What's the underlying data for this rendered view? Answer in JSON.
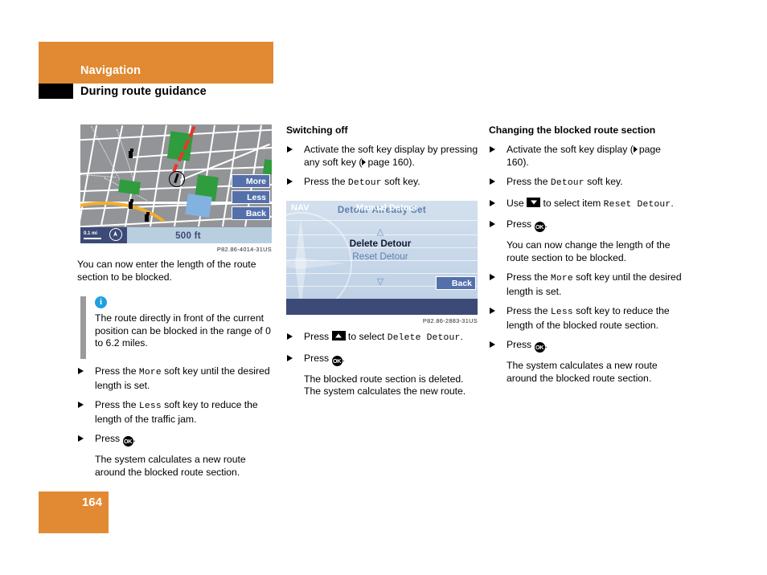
{
  "header": {
    "chapter": "Navigation",
    "section": "During route guidance"
  },
  "page": {
    "number": "164"
  },
  "figures": {
    "map": {
      "caption": "P82.86-4014-31US",
      "softkeys": [
        "More",
        "Less",
        "Back"
      ],
      "scale_label": "0.1 mi",
      "distance": "500 ft"
    },
    "detour": {
      "caption": "P82.86-2883-31US",
      "title": "Detour Already Set",
      "up_arrow": "△",
      "down_arrow": "▽",
      "item_selected": "Delete Detour",
      "item_other": "Reset Detour",
      "back_key": "Back",
      "footer_left": "NAV",
      "footer_center": "Manual Detour"
    }
  },
  "column1": {
    "intro": "You can now enter the length of the route section to be blocked.",
    "note": {
      "icon": "i",
      "text": "The route directly in front of the current position can be blocked in the range of 0 to 6.2 miles."
    },
    "steps": [
      {
        "pre": "Press the ",
        "key": "More",
        "post": " soft key until the desired length is set."
      },
      {
        "pre": "Press the ",
        "key": "Less",
        "post": " soft key to reduce the length of the traffic jam."
      }
    ],
    "press_ok_label": "Press ",
    "press_ok_suffix": ".",
    "ok_glyph": "OK",
    "result": "The system calculates a new route around the blocked route section."
  },
  "column2": {
    "title": "Switching off",
    "step1": {
      "text": "Activate the soft key display by pressing any soft key (",
      "ref": "page 160",
      "close": ")."
    },
    "step2": {
      "pre": "Press the ",
      "key": "Detour",
      "post": " soft key."
    },
    "step3": {
      "pre": "Press ",
      "mid": " to select ",
      "key": "Delete Detour",
      "post": "."
    },
    "step4": {
      "pre": "Press ",
      "post": "."
    },
    "result": "The blocked route section is deleted. The system calculates the new route."
  },
  "column3": {
    "title": "Changing the blocked route section",
    "step1": {
      "text": "Activate the soft key display (",
      "ref": "page 160",
      "close": ")."
    },
    "step2": {
      "pre": "Press the ",
      "key": "Detour",
      "post": " soft key."
    },
    "step3": {
      "pre": "Use ",
      "mid": " to select item ",
      "key": "Reset Detour",
      "post": "."
    },
    "step4": {
      "pre": "Press ",
      "post": "."
    },
    "note1": "You can now change the length of the route section to be blocked.",
    "step5": {
      "pre": "Press the ",
      "key": "More",
      "post": " soft key until the desired length is set."
    },
    "step6": {
      "pre": "Press the ",
      "key": "Less",
      "post": " soft key to reduce the length of the blocked route section."
    },
    "step7": {
      "pre": "Press ",
      "post": "."
    },
    "result": "The system calculates a new route around the blocked route section."
  },
  "colors": {
    "accent_orange": "#e28a33",
    "nav_blue": "#3c4a77",
    "softkey_blue": "#5470ab",
    "info_blue": "#1f9fe0"
  }
}
